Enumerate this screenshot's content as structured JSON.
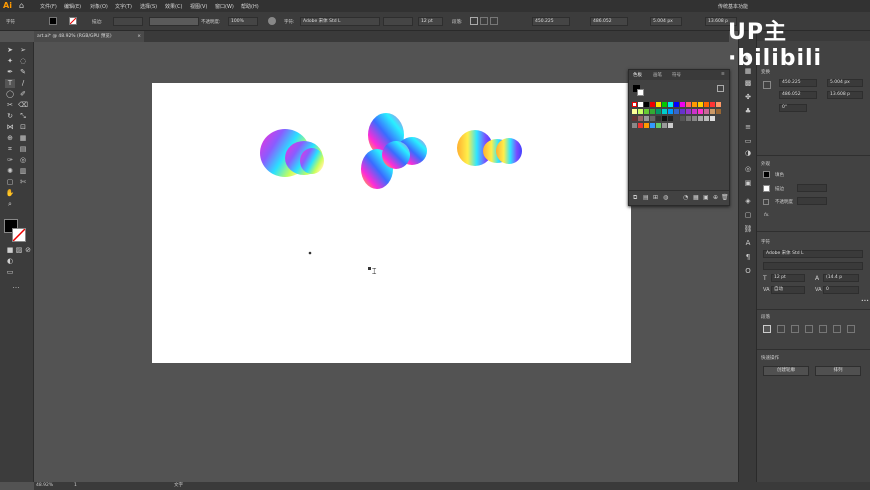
{
  "app": {
    "logo": "Ai",
    "workspace": "传统基本功能"
  },
  "menu": [
    "文件(F)",
    "编辑(E)",
    "对象(O)",
    "文字(T)",
    "选择(S)",
    "效果(C)",
    "视图(V)",
    "窗口(W)",
    "帮助(H)"
  ],
  "control": {
    "mode_label": "字符",
    "stroke_label": "描边:",
    "opacity_label": "不透明度:",
    "opacity_value": "100%",
    "char_label": "字符:",
    "font_name": "Adobe 宋体 Std L",
    "font_size": "12 pt",
    "para_label": "段落:",
    "x_value": "450.225",
    "y_value": "486.052",
    "w_value": "5.004 px",
    "h_value": "13.608 p"
  },
  "document": {
    "tab_title": "art.ai* @ 48.92% (RGB/GPU 预览)",
    "close": "×"
  },
  "swatches_panel": {
    "tabs": [
      "色板",
      "画笔",
      "符号"
    ]
  },
  "right_panel": {
    "section_transform": "变换",
    "x": "450.225",
    "w": "5.004 px",
    "y": "486.052",
    "h": "13.608 p",
    "angle": "0°",
    "section_appearance": "外观",
    "fill_label": "填色",
    "stroke_label": "描边",
    "opacity_label": "不透明度",
    "fx_label": "fx.",
    "section_char": "字符",
    "font_name": "Adobe 宋体 Std L",
    "size": "12 pt",
    "leading": "(14.4 p",
    "tracking": "0",
    "kern": "自动",
    "section_para": "段落",
    "section_quick": "快速操作",
    "btn_outline": "创建轮廓",
    "btn_arrange": "排列"
  },
  "status": {
    "zoom": "48.92%",
    "page": "1",
    "tool": "文字"
  },
  "watermark": "UP主·bilibili",
  "colors": {
    "accent": "#ff9a00",
    "ui_bg": "#535353",
    "panel": "#424242"
  }
}
